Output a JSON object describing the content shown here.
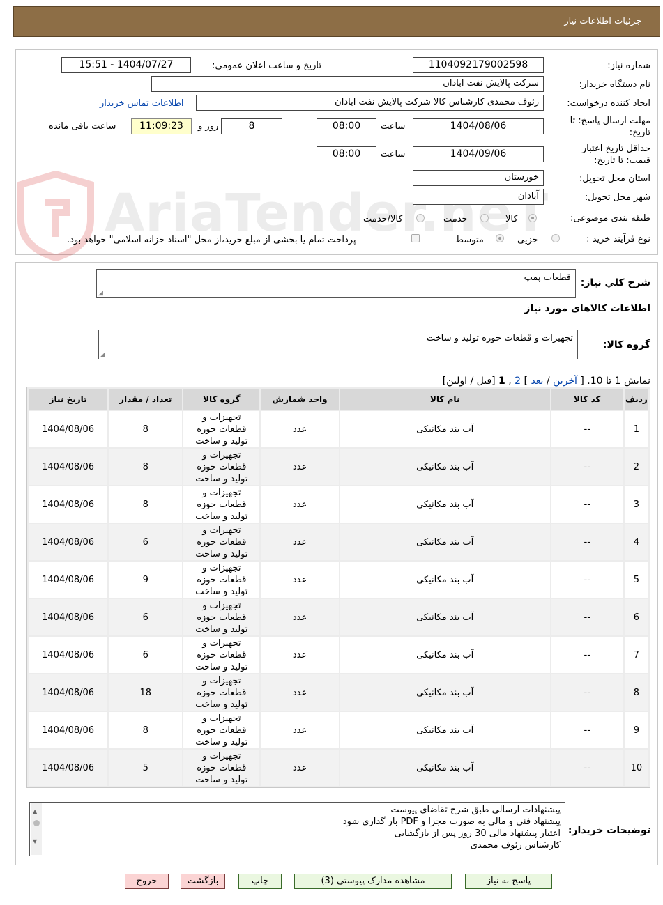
{
  "header": {
    "title": "جزئیات اطلاعات نیاز"
  },
  "watermark": {
    "text": "AriaTender.neT"
  },
  "form": {
    "need_number_label": "شماره نیاز:",
    "need_number": "1104092179002598",
    "announce_label": "تاریخ و ساعت اعلان عمومی:",
    "announce_value": "1404/07/27 - 15:51",
    "buyer_org_label": "نام دستگاه خریدار:",
    "buyer_org": "شرکت پالایش نفت ابادان",
    "creator_label": "ایجاد کننده درخواست:",
    "creator": "رئوف محمدی کارشناس کالا شرکت پالایش نفت ابادان",
    "contact_link": "اطلاعات تماس خریدار",
    "deadline_label_1": "مهلت ارسال پاسخ: تا",
    "deadline_label_2": "تاریخ:",
    "deadline_date": "1404/08/06",
    "time_label": "ساعت",
    "deadline_time": "08:00",
    "days_value": "8",
    "days_label": "روز و",
    "remaining_time": "11:09:23",
    "remaining_label": "ساعت باقی مانده",
    "validity_label_1": "حداقل تاریخ اعتبار",
    "validity_label_2": "قیمت: تا تاریخ:",
    "validity_date": "1404/09/06",
    "validity_time": "08:00",
    "province_label": "استان محل تحویل:",
    "province": "خوزستان",
    "city_label": "شهر محل تحویل:",
    "city": "آبادان",
    "category_label": "طبقه بندی موضوعی:",
    "category_options": [
      "کالا",
      "خدمت",
      "کالا/خدمت"
    ],
    "category_selected": "کالا",
    "process_label": "نوع فرآیند خرید :",
    "process_options": [
      "جزیی",
      "متوسط"
    ],
    "process_selected": "متوسط",
    "treasury_note": "پرداخت تمام یا بخشی از مبلغ خرید،از محل \"اسناد خزانه اسلامی\" خواهد بود."
  },
  "summary": {
    "general_desc_label": "شرح کلي نياز:",
    "general_desc": "قطعات پمپ",
    "goods_info_title": "اطلاعات کالاهای مورد نیاز",
    "goods_group_label": "گروه کالا:",
    "goods_group": "تجهیزات و قطعات حوزه تولید و ساخت"
  },
  "pagination": {
    "show_prefix": "نمایش 1 تا 10. [",
    "last": "آخرین",
    "sep1": " / ",
    "next": "بعد",
    "close1": "] ",
    "page2": "2",
    "comma": " ,",
    "page1": "1",
    "tail": " [قبل / اولین]"
  },
  "table": {
    "headers": [
      "ردیف",
      "کد کالا",
      "نام کالا",
      "واحد شمارش",
      "گروه کالا",
      "تعداد / مقدار",
      "تاریخ نیاز"
    ],
    "rows": [
      [
        "1",
        "--",
        "آب بند مکانیکی",
        "عدد",
        "تجهیزات و قطعات حوزه تولید و ساخت",
        "8",
        "1404/08/06"
      ],
      [
        "2",
        "--",
        "آب بند مکانیکی",
        "عدد",
        "تجهیزات و قطعات حوزه تولید و ساخت",
        "8",
        "1404/08/06"
      ],
      [
        "3",
        "--",
        "آب بند مکانیکی",
        "عدد",
        "تجهیزات و قطعات حوزه تولید و ساخت",
        "8",
        "1404/08/06"
      ],
      [
        "4",
        "--",
        "آب بند مکانیکی",
        "عدد",
        "تجهیزات و قطعات حوزه تولید و ساخت",
        "6",
        "1404/08/06"
      ],
      [
        "5",
        "--",
        "آب بند مکانیکی",
        "عدد",
        "تجهیزات و قطعات حوزه تولید و ساخت",
        "9",
        "1404/08/06"
      ],
      [
        "6",
        "--",
        "آب بند مکانیکی",
        "عدد",
        "تجهیزات و قطعات حوزه تولید و ساخت",
        "6",
        "1404/08/06"
      ],
      [
        "7",
        "--",
        "آب بند مکانیکی",
        "عدد",
        "تجهیزات و قطعات حوزه تولید و ساخت",
        "6",
        "1404/08/06"
      ],
      [
        "8",
        "--",
        "آب بند مکانیکی",
        "عدد",
        "تجهیزات و قطعات حوزه تولید و ساخت",
        "18",
        "1404/08/06"
      ],
      [
        "9",
        "--",
        "آب بند مکانیکی",
        "عدد",
        "تجهیزات و قطعات حوزه تولید و ساخت",
        "8",
        "1404/08/06"
      ],
      [
        "10",
        "--",
        "آب بند مکانیکی",
        "عدد",
        "تجهیزات و قطعات حوزه تولید و ساخت",
        "5",
        "1404/08/06"
      ]
    ]
  },
  "buyer_notes": {
    "label": "توضیحات خریدار:",
    "lines": [
      "پیشنهادات ارسالی طبق شرح تقاضای پیوست",
      "پیشنهاد فنی و مالی به صورت مجزا و PDF بار گذاری شود",
      "اعتبار پیشنهاد مالی 30 روز پس از بازگشایی",
      "کارشناس رئوف محمدی"
    ]
  },
  "buttons": {
    "reply": "پاسخ به نیاز",
    "attachments": "مشاهده مدارک پیوستي (3)",
    "print": "چاپ",
    "back": "بازگشت",
    "exit": "خروج"
  }
}
